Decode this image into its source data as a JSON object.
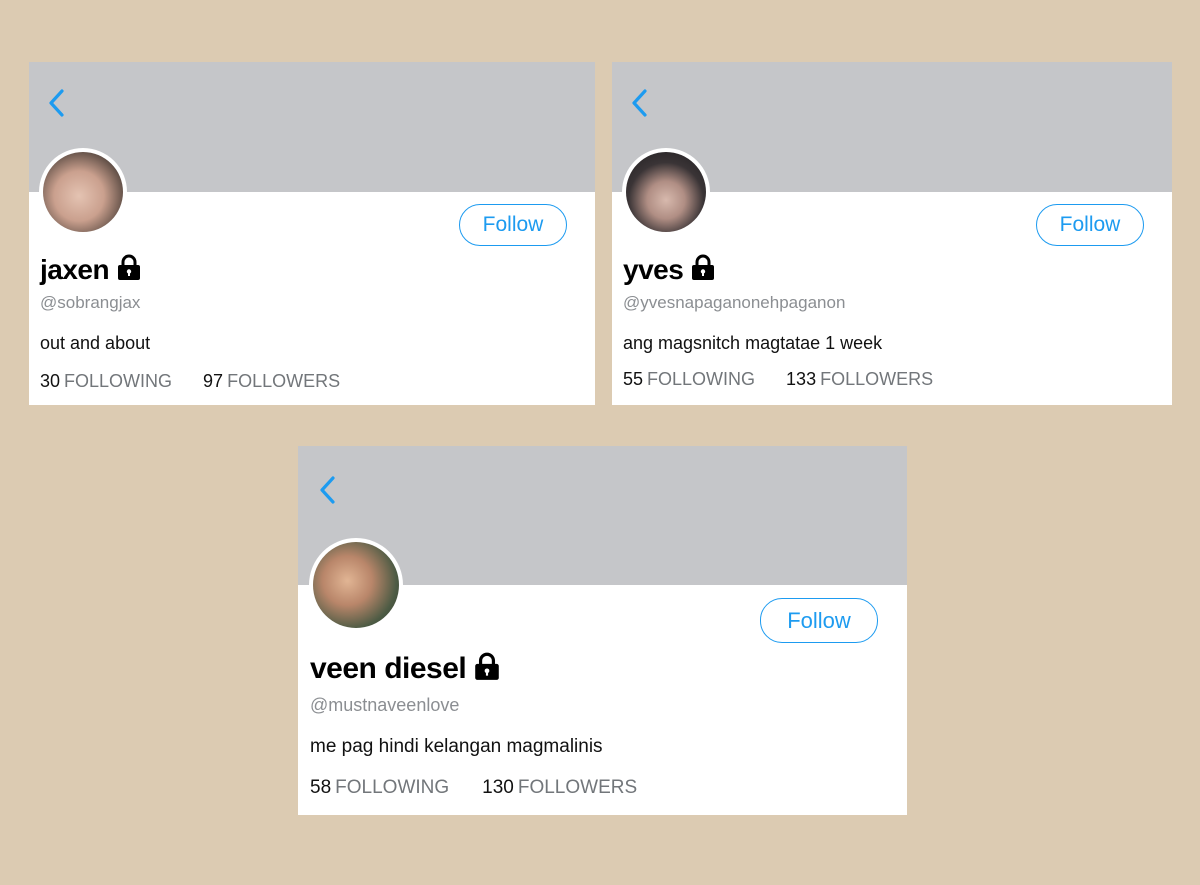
{
  "colors": {
    "background": "#dccbb2",
    "header_banner": "#c5c6c9",
    "accent": "#1d9bf0",
    "secondary_text": "#72767a"
  },
  "icons": {
    "back": "chevron-left-icon",
    "lock": "lock-icon"
  },
  "profiles": [
    {
      "display_name": "jaxen",
      "handle": "@sobrangjax",
      "bio": "out and about",
      "follow_label": "Follow",
      "following_count": "30",
      "following_label": "FOLLOWING",
      "followers_count": "97",
      "followers_label": "FOLLOWERS"
    },
    {
      "display_name": "yves",
      "handle": "@yvesnapaganonehpaganon",
      "bio": "ang magsnitch magtatae 1 week",
      "follow_label": "Follow",
      "following_count": "55",
      "following_label": "FOLLOWING",
      "followers_count": "133",
      "followers_label": "FOLLOWERS"
    },
    {
      "display_name": "veen diesel",
      "handle": "@mustnaveenlove",
      "bio": "me pag hindi kelangan magmalinis",
      "follow_label": "Follow",
      "following_count": "58",
      "following_label": "FOLLOWING",
      "followers_count": "130",
      "followers_label": "FOLLOWERS"
    }
  ]
}
